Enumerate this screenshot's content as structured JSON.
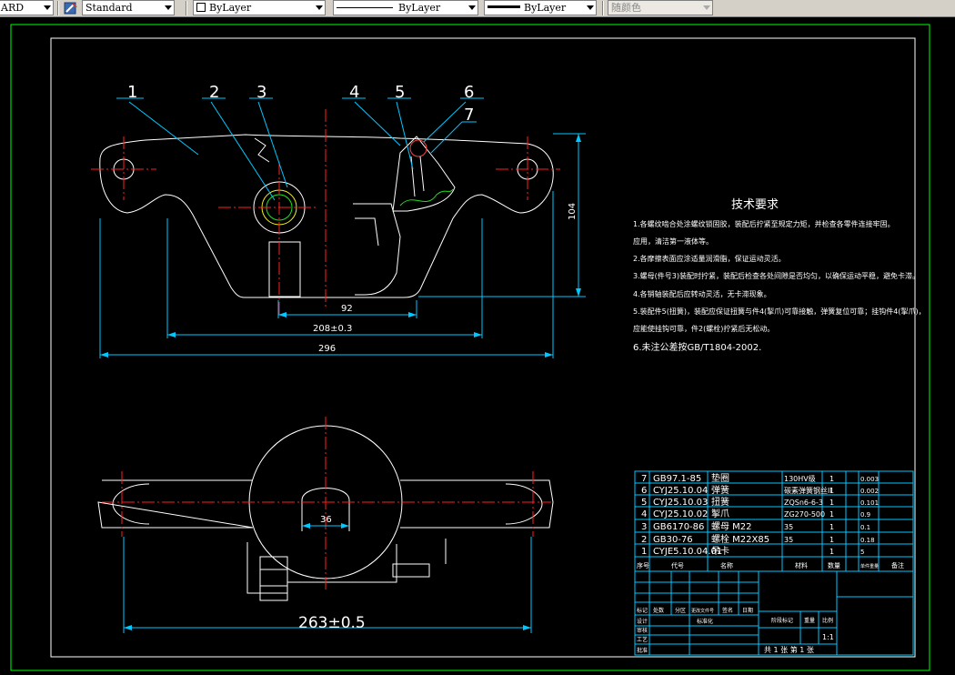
{
  "toolbar": {
    "combo_left": "ARD",
    "text_style": "Standard",
    "layer_color": "ByLayer",
    "linetype": "ByLayer",
    "lineweight": "ByLayer",
    "plot_style": "随颜色"
  },
  "colors": {
    "background": "#000000",
    "outline": "#ffffff",
    "dimension": "#00c8ff",
    "center": "#ff2020",
    "frame": "#00ff00",
    "hidden": "#f0f020",
    "spring": "#20e020"
  },
  "drawing": {
    "balloons": [
      "1",
      "2",
      "3",
      "4",
      "5",
      "6",
      "7"
    ],
    "dims": {
      "d104": "104",
      "d92": "92",
      "d208": "208±0.3",
      "d296": "296",
      "d36": "36",
      "d263": "263±0.5"
    }
  },
  "notes": {
    "title": "技术要求",
    "lines": [
      "1.各螺纹啮合处涂螺纹锁固胶，装配后拧紧至规定力矩，并检查各零件连接牢固。",
      "应用，清洁第一液体等。",
      "2.各摩擦表面应涂适量润滑脂，保证运动灵活。",
      "3.螺母(件号3)装配时拧紧，装配后检查各处间隙是否均匀，以确保运动平稳，避免卡滞。",
      "4.各销轴装配后应转动灵活，无卡滞现象。",
      "5.装配件5(扭簧)，装配应保证扭簧与件4(掣爪)可靠接触，弹簧复位可靠；挂钩件4(掣爪)，",
      "应能使挂钩可靠，件2(螺栓)拧紧后无松动。",
      "6.未注公差按GB/T1804-2002."
    ]
  },
  "bom": {
    "rows": [
      {
        "no": "7",
        "code": "GB97.1-85",
        "name": "垫圈",
        "mat": "130HV级",
        "qty": "1",
        "w": "0.003"
      },
      {
        "no": "6",
        "code": "CYJ25.10.04",
        "name": "弹簧",
        "mat": "碳素弹簧钢丝II",
        "qty": "1",
        "w": "0.002"
      },
      {
        "no": "5",
        "code": "CYJ25.10.03",
        "name": "扭簧",
        "mat": "ZQSn6-6-3",
        "qty": "1",
        "w": "0.101"
      },
      {
        "no": "4",
        "code": "CYJ25.10.02",
        "name": "掣爪",
        "mat": "ZG270-500",
        "qty": "1",
        "w": "0.9"
      },
      {
        "no": "3",
        "code": "GB6170-86",
        "name": "螺母 M22",
        "mat": "35",
        "qty": "1",
        "w": "0.1"
      },
      {
        "no": "2",
        "code": "GB30-76",
        "name": "螺栓 M22X85",
        "mat": "35",
        "qty": "1",
        "w": "0.18"
      },
      {
        "no": "1",
        "code": "CYJE5.10.04.01",
        "name": "吊卡",
        "mat": "",
        "qty": "1",
        "w": "5"
      }
    ],
    "header": [
      "序号",
      "代号",
      "名称",
      "材料",
      "数量",
      "单件重量",
      "备注"
    ],
    "title_block": {
      "labels": [
        "标记",
        "处数",
        "分区",
        "更改文件号",
        "签名",
        "日期"
      ],
      "rows_left": [
        "设计",
        "审核",
        "工艺",
        "批准"
      ],
      "std": "标准化",
      "stage": "阶段标记",
      "weight": "重量",
      "scale": "比例",
      "scale_val": "1:1",
      "sheet": "共 1 张 第 1 张"
    }
  }
}
